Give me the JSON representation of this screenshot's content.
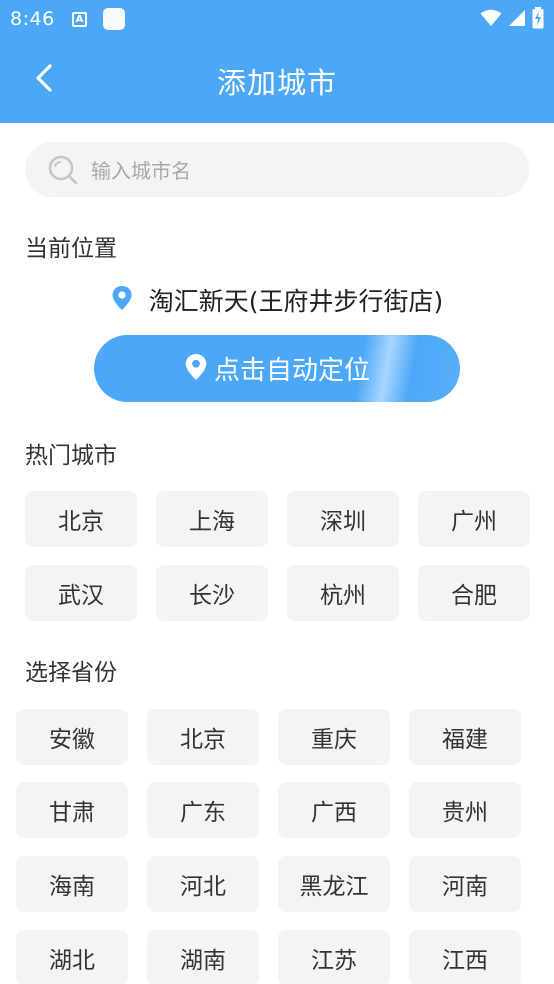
{
  "status_bar": {
    "time": "8:46",
    "notification_a": "A",
    "icons": [
      "wifi-icon",
      "signal-icon",
      "battery-charging-icon"
    ]
  },
  "app_bar": {
    "title": "添加城市",
    "back_icon": "chevron-left-icon"
  },
  "search": {
    "placeholder": "输入城市名",
    "icon": "search-icon"
  },
  "current_location": {
    "section_title": "当前位置",
    "location_name": "淘汇新天(王府井步行街店)",
    "locate_button_label": "点击自动定位",
    "pin_icon": "location-pin-icon"
  },
  "hot_cities": {
    "section_title": "热门城市",
    "items": [
      "北京",
      "上海",
      "深圳",
      "广州",
      "武汉",
      "长沙",
      "杭州",
      "合肥"
    ]
  },
  "provinces": {
    "section_title": "选择省份",
    "items": [
      "安徽",
      "北京",
      "重庆",
      "福建",
      "甘肃",
      "广东",
      "广西",
      "贵州",
      "海南",
      "河北",
      "黑龙江",
      "河南",
      "湖北",
      "湖南",
      "江苏",
      "江西"
    ]
  },
  "colors": {
    "primary": "#4ca8f7",
    "chip_background": "#f4f4f4",
    "text": "#333333",
    "placeholder": "#a8a8a8"
  }
}
